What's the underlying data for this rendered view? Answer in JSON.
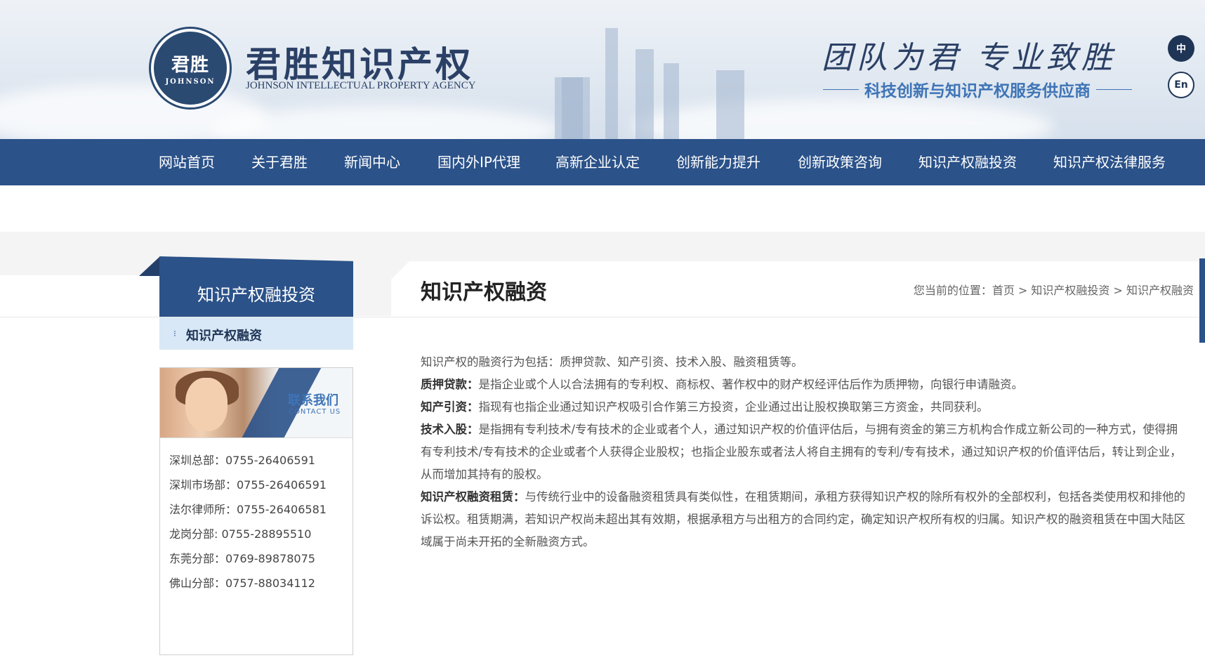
{
  "header": {
    "logo_badge_cn": "君胜",
    "logo_badge_en": "JOHNSON",
    "brand_name": "君胜知识产权",
    "brand_name_en": "JOHNSON INTELLECTUAL PROPERTY AGENCY",
    "slogan": "团队为君  专业致胜",
    "slogan_sub": "科技创新与知识产权服务供应商",
    "lang_zh": "中",
    "lang_en": "En"
  },
  "nav": {
    "items": [
      {
        "label": "网站首页"
      },
      {
        "label": "关于君胜"
      },
      {
        "label": "新闻中心"
      },
      {
        "label": "国内外IP代理"
      },
      {
        "label": "高新企业认定"
      },
      {
        "label": "创新能力提升"
      },
      {
        "label": "创新政策咨询"
      },
      {
        "label": "知识产权融投资"
      },
      {
        "label": "知识产权法律服务"
      }
    ]
  },
  "sidebar": {
    "title": "知识产权融投资",
    "items": [
      {
        "label": "知识产权融资"
      }
    ],
    "contact": {
      "title": "联系我们",
      "title_en": "CONTACT US",
      "lines": [
        "深圳总部：0755-26406591",
        "深圳市场部：0755-26406591",
        "法尔律师所：0755-26406581",
        "龙岗分部:  0755-28895510",
        "东莞分部：0769-89878075",
        "佛山分部：0757-88034112"
      ]
    }
  },
  "main": {
    "title": "知识产权融资",
    "breadcrumb": "您当前的位置：首页 > 知识产权融投资 > 知识产权融资",
    "intro": "知识产权的融资行为包括：质押贷款、知产引资、技术入股、融资租赁等。",
    "sections": [
      {
        "term": "质押贷款：",
        "text": "是指企业或个人以合法拥有的专利权、商标权、著作权中的财产权经评估后作为质押物，向银行申请融资。"
      },
      {
        "term": "知产引资：",
        "text": "指现有也指企业通过知识产权吸引合作第三方投资，企业通过出让股权换取第三方资金，共同获利。"
      },
      {
        "term": "技术入股：",
        "text": "是指拥有专利技术/专有技术的企业或者个人，通过知识产权的价值评估后，与拥有资金的第三方机构合作成立新公司的一种方式，使得拥有专利技术/专有技术的企业或者个人获得企业股权；也指企业股东或者法人将自主拥有的专利/专有技术，通过知识产权的价值评估后，转让到企业，从而增加其持有的股权。"
      },
      {
        "term": "知识产权融资租赁：",
        "text": "与传统行业中的设备融资租赁具有类似性，在租赁期间，承租方获得知识产权的除所有权外的全部权利，包括各类使用权和排他的诉讼权。租赁期满，若知识产权尚未超出其有效期，根据承租方与出租方的合同约定，确定知识产权所有权的归属。知识产权的融资租赁在中国大陆区域属于尚未开拓的全新融资方式。"
      }
    ]
  },
  "colors": {
    "nav_bg": "#2b5289",
    "brand_dark": "#2b4066",
    "accent_blue": "#3e74b6",
    "submenu_bg": "#d9e8f6"
  }
}
